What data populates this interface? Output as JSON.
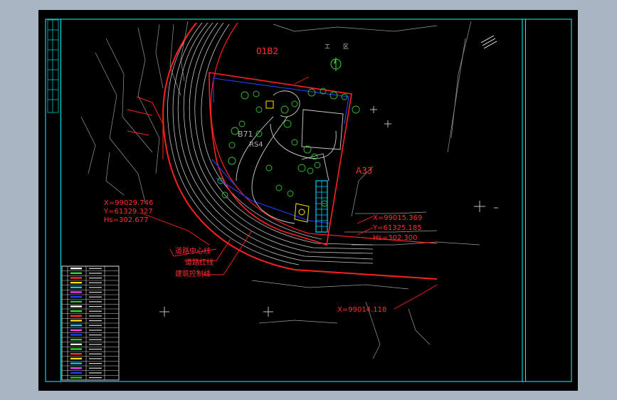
{
  "colors": {
    "background": "#000000",
    "frame": "#00ffff",
    "redline": "#ff2020",
    "road": "#c8c8c8",
    "building": "#2040ff",
    "tree": "#30c030",
    "label_red": "#ff3030",
    "parking": "#00d0ff"
  },
  "labels": {
    "zone_north": "01B2",
    "zone_b": "B71",
    "zone_s": "RS4",
    "zone_east": "A33",
    "road_centerline": "道路中心线",
    "road_redline": "道路红线",
    "setback_line": "建筑控制线",
    "field_text_1": "工",
    "field_text_2": "区"
  },
  "coords": {
    "west_x": "X=99029.746",
    "west_y": "Y=61329.327",
    "west_h": "Hs=302.677",
    "east_x": "X=99015.369",
    "east_y": "Y=61325.185",
    "east_h": "Hs=302.300",
    "south_x": "X=99014.118"
  },
  "legend": {
    "rows": 24
  }
}
